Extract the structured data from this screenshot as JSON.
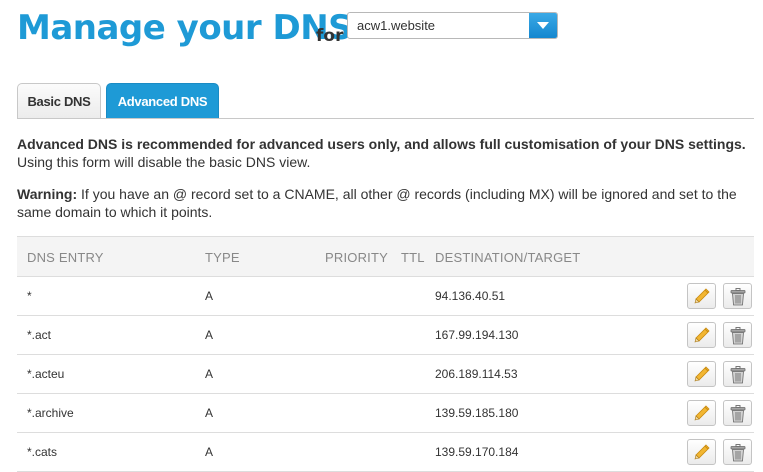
{
  "header": {
    "title": "Manage your DNS",
    "for_label": "for",
    "domain_selected": "acw1.website"
  },
  "tabs": [
    {
      "label": "Basic DNS",
      "active": false
    },
    {
      "label": "Advanced DNS",
      "active": true
    }
  ],
  "intro": {
    "bold": "Advanced DNS is recommended for advanced users only, and allows full customisation of your DNS settings.",
    "normal": " Using this form will disable the basic DNS view."
  },
  "warning": {
    "bold": "Warning:",
    "normal": " If you have an @ record set to a CNAME, all other @ records (including MX) will be ignored and set to the same domain to which it points."
  },
  "table": {
    "headers": {
      "entry": "DNS ENTRY",
      "type": "TYPE",
      "priority": "PRIORITY",
      "ttl": "TTL",
      "destination": "DESTINATION/TARGET"
    },
    "rows": [
      {
        "entry": "*",
        "type": "A",
        "priority": "",
        "ttl": "",
        "destination": "94.136.40.51"
      },
      {
        "entry": "*.act",
        "type": "A",
        "priority": "",
        "ttl": "",
        "destination": "167.99.194.130"
      },
      {
        "entry": "*.acteu",
        "type": "A",
        "priority": "",
        "ttl": "",
        "destination": "206.189.114.53"
      },
      {
        "entry": "*.archive",
        "type": "A",
        "priority": "",
        "ttl": "",
        "destination": "139.59.185.180"
      },
      {
        "entry": "*.cats",
        "type": "A",
        "priority": "",
        "ttl": "",
        "destination": "139.59.170.184"
      }
    ]
  },
  "colors": {
    "brand": "#1e9ad6",
    "header_bg": "#f4f4f4",
    "pencil": "#e5a81a"
  },
  "icons": {
    "select_arrow": "chevron-down-icon",
    "edit": "pencil-icon",
    "delete": "trash-icon"
  }
}
